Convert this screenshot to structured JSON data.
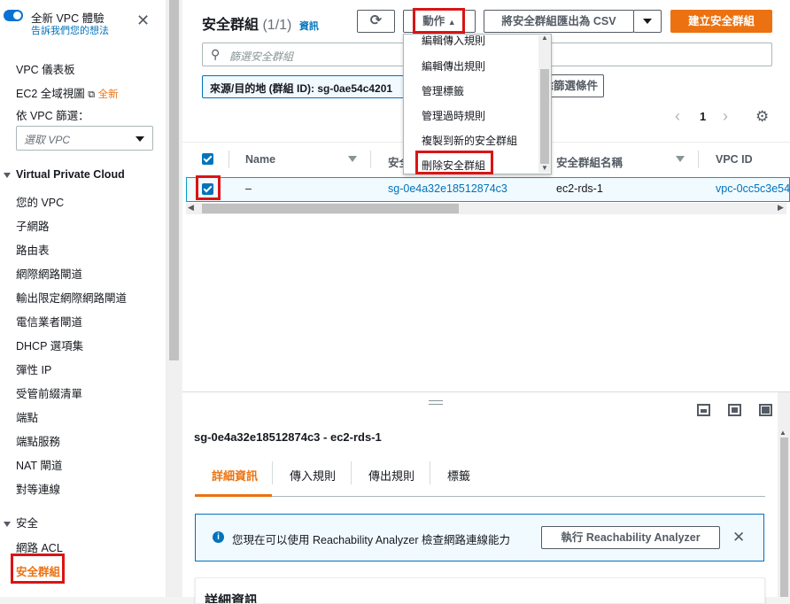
{
  "sidebar": {
    "new_vpc_experience": "全新 VPC 體驗",
    "feedback_link": "告訴我們您的想法",
    "dashboard": "VPC 儀表板",
    "ec2_global_view": "EC2 全域視圖",
    "new_badge": "全新",
    "filter_by_vpc_label": "依 VPC 篩選：",
    "vpc_select_placeholder": "選取 VPC",
    "vpc_section": "Virtual Private Cloud",
    "vpc_items": [
      "您的 VPC",
      "子網路",
      "路由表",
      "網際網路閘道",
      "輸出限定網際網路閘道",
      "電信業者閘道",
      "DHCP 選項集",
      "彈性 IP",
      "受管前綴清單",
      "端點",
      "端點服務",
      "NAT 閘道",
      "對等連線"
    ],
    "security_section": "安全",
    "security_items": [
      "網路 ACL",
      "安全群組"
    ]
  },
  "header": {
    "title": "安全群組",
    "count": "(1/1)",
    "info_link": "資訊",
    "refresh_icon": "refresh-icon",
    "actions_label": "動作",
    "export_label": "將安全群組匯出為 CSV",
    "create_label": "建立安全群組"
  },
  "search": {
    "placeholder": "篩選安全群組"
  },
  "filter_token": {
    "text": "來源/目的地 (群組 ID): sg-0ae54c4201",
    "clear_label": "清除篩選條件"
  },
  "pagination": {
    "page": "1"
  },
  "actions_menu": {
    "items": [
      "編輯傳入規則",
      "編輯傳出規則",
      "管理標籤",
      "管理過時規則",
      "複製到新的安全群組",
      "刪除安全群組"
    ]
  },
  "table": {
    "columns": [
      "Name",
      "安全群組 ID",
      "安全群組名稱",
      "VPC ID"
    ],
    "rows": [
      {
        "name": "–",
        "sg_id": "sg-0e4a32e18512874c3",
        "sg_name": "ec2-rds-1",
        "vpc_id": "vpc-0cc5c3e54"
      }
    ]
  },
  "details": {
    "heading": "sg-0e4a32e18512874c3 - ec2-rds-1",
    "tabs": [
      "詳細資訊",
      "傳入規則",
      "傳出規則",
      "標籤"
    ],
    "info_text": "您現在可以使用 Reachability Analyzer 檢查網路連線能力",
    "run_button": "執行 Reachability Analyzer",
    "section_title": "詳細資訊"
  },
  "colors": {
    "accent": "#ec7211",
    "link": "#0073bb",
    "highlight": "#d91515"
  }
}
